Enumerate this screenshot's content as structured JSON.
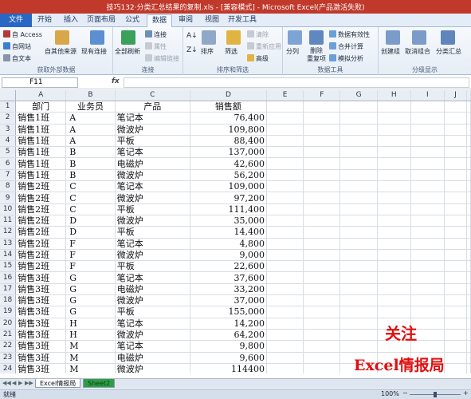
{
  "window": {
    "title": "技巧132·分类汇总结果的复制.xls - [兼容模式] - Microsoft Excel(产品激活失败)"
  },
  "tabs": [
    "文件",
    "开始",
    "插入",
    "页面布局",
    "公式",
    "数据",
    "审阅",
    "视图",
    "开发工具"
  ],
  "active_tab": "数据",
  "ribbon": {
    "external": {
      "label": "获取外部数据",
      "access": "自 Access",
      "web": "自网站",
      "text": "自文本",
      "other": "自其他来源",
      "existing": "现有连接"
    },
    "connections": {
      "label": "连接",
      "refresh_all": "全部刷新",
      "connections": "连接",
      "properties": "属性",
      "edit_links": "编辑链接"
    },
    "sort_filter": {
      "label": "排序和筛选",
      "sort": "排序",
      "filter": "筛选",
      "clear": "清除",
      "reapply": "重新应用",
      "advanced": "高级"
    },
    "data_tools": {
      "label": "数据工具",
      "text_to_columns": "分列",
      "remove_duplicates": "删除\n重复项",
      "validation": "数据有效性",
      "consolidate": "合并计算",
      "what_if": "模拟分析"
    },
    "outline": {
      "label": "分级显示",
      "group": "创建组",
      "ungroup": "取消组合",
      "subtotal": "分类汇总"
    }
  },
  "formula_bar": {
    "name_box": "F11",
    "fx": "fx",
    "formula": ""
  },
  "columns": [
    "A",
    "B",
    "C",
    "D",
    "E",
    "F",
    "G",
    "H",
    "I",
    "J"
  ],
  "rows": [
    [
      "部门",
      "业务员",
      "产品",
      "销售额"
    ],
    [
      "销售1班",
      "A",
      "笔记本",
      "76,400"
    ],
    [
      "销售1班",
      "A",
      "微波炉",
      "109,800"
    ],
    [
      "销售1班",
      "A",
      "平板",
      "88,400"
    ],
    [
      "销售1班",
      "B",
      "笔记本",
      "137,000"
    ],
    [
      "销售1班",
      "B",
      "电磁炉",
      "42,600"
    ],
    [
      "销售1班",
      "B",
      "微波炉",
      "56,200"
    ],
    [
      "销售2班",
      "C",
      "笔记本",
      "109,000"
    ],
    [
      "销售2班",
      "C",
      "微波炉",
      "97,200"
    ],
    [
      "销售2班",
      "C",
      "平板",
      "111,400"
    ],
    [
      "销售2班",
      "D",
      "微波炉",
      "35,000"
    ],
    [
      "销售2班",
      "D",
      "平板",
      "14,400"
    ],
    [
      "销售2班",
      "F",
      "笔记本",
      "4,800"
    ],
    [
      "销售2班",
      "F",
      "微波炉",
      "9,000"
    ],
    [
      "销售2班",
      "F",
      "平板",
      "22,600"
    ],
    [
      "销售3班",
      "G",
      "笔记本",
      "37,600"
    ],
    [
      "销售3班",
      "G",
      "电磁炉",
      "33,200"
    ],
    [
      "销售3班",
      "G",
      "微波炉",
      "37,000"
    ],
    [
      "销售3班",
      "G",
      "平板",
      "155,000"
    ],
    [
      "销售3班",
      "H",
      "笔记本",
      "14,200"
    ],
    [
      "销售3班",
      "H",
      "微波炉",
      "64,200"
    ],
    [
      "销售3班",
      "M",
      "笔记本",
      "9,800"
    ],
    [
      "销售3班",
      "M",
      "电磁炉",
      "9,600"
    ],
    [
      "销售3班",
      "M",
      "微波炉",
      "114400"
    ]
  ],
  "sheets": [
    "Excel情报局",
    "Sheet2"
  ],
  "active_sheet": "Excel情报局",
  "watermark": {
    "line1": "关注",
    "line2": "Excel情报局"
  },
  "status": {
    "ready": "就绪",
    "zoom": "100%"
  },
  "colors": {
    "title_bar": "#c0392b",
    "file_tab": "#2a67c4",
    "watermark": "#e01010",
    "sheet2_tab": "#2e9e44"
  }
}
